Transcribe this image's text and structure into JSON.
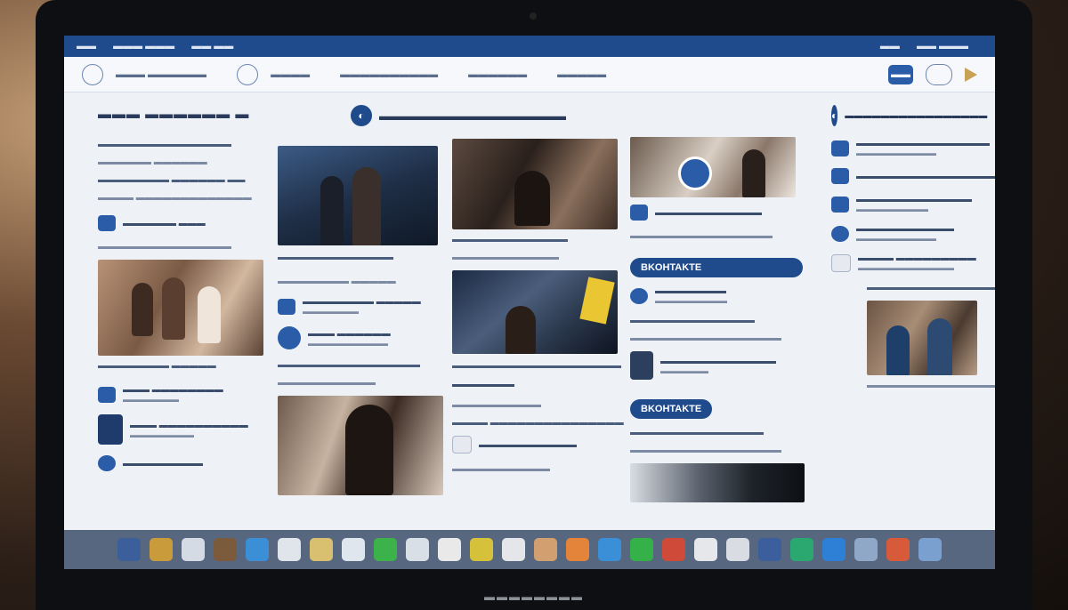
{
  "menubar": {
    "left": [
      "▬▬",
      "▬▬▬ ▬▬▬",
      "▬▬ ▬▬"
    ],
    "right": [
      "▬▬",
      "▬▬ ▬▬▬"
    ]
  },
  "topnav": {
    "items": [
      "▬▬▬ ▬▬▬▬▬▬",
      "▬▬▬▬",
      "▬▬▬▬▬▬▬▬▬▬",
      "▬▬▬▬▬▬",
      "▬▬▬▬▬"
    ],
    "badge": "▬▬"
  },
  "left": {
    "title": "▬▬▬ ▬▬▬▬▬▬ ▬",
    "lines": [
      "▬▬▬▬▬▬▬▬▬▬▬▬▬▬▬",
      "▬▬▬▬▬▬ ▬▬▬▬▬▬",
      "▬▬▬▬▬▬▬▬ ▬▬▬▬▬▬ ▬▬",
      "▬▬▬▬ ▬▬▬▬▬▬▬▬▬▬▬▬▬"
    ],
    "icon_lines": [
      "▬▬▬▬▬▬ ▬▬▬",
      "▬▬▬▬▬▬▬▬▬▬▬▬▬▬▬"
    ],
    "caption": "▬▬▬▬▬▬▬▬ ▬▬▬▬▬",
    "rows": [
      {
        "title": "▬▬▬ ▬▬▬▬▬▬▬▬",
        "sub": "▬▬▬▬▬▬▬"
      },
      {
        "title": "▬▬▬ ▬▬▬▬▬▬▬▬▬▬",
        "sub": "▬▬▬▬▬▬▬▬"
      },
      {
        "title": "▬▬▬▬▬▬▬▬▬",
        "sub": ""
      }
    ]
  },
  "center1": {
    "caption1": "▬▬▬▬▬▬▬▬▬▬▬▬▬",
    "caption2": "▬▬▬▬▬▬▬▬ ▬▬▬▬▬",
    "rows": [
      {
        "title": "▬▬▬▬▬▬▬▬ ▬▬▬▬▬",
        "sub": "▬▬▬▬▬▬▬"
      },
      {
        "title": "▬▬▬ ▬▬▬▬▬▬",
        "sub": "▬▬▬▬▬▬▬▬▬▬"
      }
    ],
    "caption3": "▬▬▬▬▬▬▬▬▬▬▬▬▬▬▬▬",
    "sub3": "▬▬▬▬▬▬▬▬▬▬▬"
  },
  "center2": {
    "brand": "▬▬▬▬▬▬▬▬▬▬▬▬▬▬▬",
    "caption1": "▬▬▬▬▬▬▬▬▬▬▬▬▬",
    "caption2": "▬▬▬▬▬▬▬▬▬▬▬▬",
    "caption3": "▬▬▬▬▬▬▬▬▬▬▬▬▬▬▬▬▬▬▬",
    "row": {
      "title": "▬▬▬▬▬▬▬",
      "sub": "▬▬▬▬▬▬▬▬▬▬"
    },
    "caption4": "▬▬▬▬ ▬▬▬▬▬▬▬▬▬▬▬▬▬▬▬",
    "row2": {
      "title": "▬▬▬▬▬▬▬▬▬▬▬",
      "sub": ""
    },
    "caption5": "▬▬▬▬▬▬▬▬▬▬▬"
  },
  "center3": {
    "row1": {
      "title": "▬▬▬▬▬▬▬▬▬▬▬▬",
      "sub": ""
    },
    "caption1": "▬▬▬▬▬▬▬▬▬▬▬▬▬▬▬▬",
    "pill1": "BKOHTAKTE",
    "row2": {
      "title": "▬▬▬▬▬▬▬▬",
      "sub": "▬▬▬▬▬▬▬▬▬"
    },
    "caption2": "▬▬▬▬▬▬▬▬▬▬▬▬▬▬",
    "caption3": "▬▬▬▬▬▬▬▬▬▬▬▬▬▬▬▬▬",
    "row3": {
      "title": "▬▬▬▬▬▬▬▬▬▬▬▬▬",
      "sub": "▬▬▬▬▬▬"
    },
    "pill2": "BKOHTAKTE",
    "caption4": "▬▬▬▬▬▬▬▬▬▬▬▬▬▬▬",
    "caption5": "▬▬▬▬▬▬▬▬▬▬▬▬▬▬▬▬▬"
  },
  "right": {
    "title": "▬▬▬▬▬▬▬▬▬▬▬▬▬▬▬▬",
    "rows": [
      {
        "title": "▬▬▬▬▬▬▬▬▬▬▬▬▬▬▬",
        "sub": "▬▬▬▬▬▬▬▬▬▬"
      },
      {
        "title": "▬▬▬▬▬▬▬▬▬▬▬▬▬▬▬▬▬",
        "sub": ""
      },
      {
        "title": "▬▬▬▬▬▬▬▬▬▬▬▬▬",
        "sub": "▬▬▬▬▬▬▬▬▬"
      },
      {
        "title": "▬▬▬▬▬▬▬▬▬▬▬",
        "sub": "▬▬▬▬▬▬▬▬▬▬"
      },
      {
        "title": "▬▬▬▬ ▬▬▬▬▬▬▬▬▬",
        "sub": "▬▬▬▬▬▬▬▬▬▬▬▬"
      }
    ],
    "photo_title": "▬▬▬▬▬▬▬▬▬▬▬▬▬▬▬",
    "photo_caption": "▬▬▬▬▬▬▬▬▬▬▬▬▬▬▬▬"
  },
  "laptop_brand": "▬▬▬▬▬▬▬▬",
  "dock": {
    "count": 26
  },
  "colors": {
    "accent": "#1f4a8c",
    "page": "#eef1f6"
  }
}
